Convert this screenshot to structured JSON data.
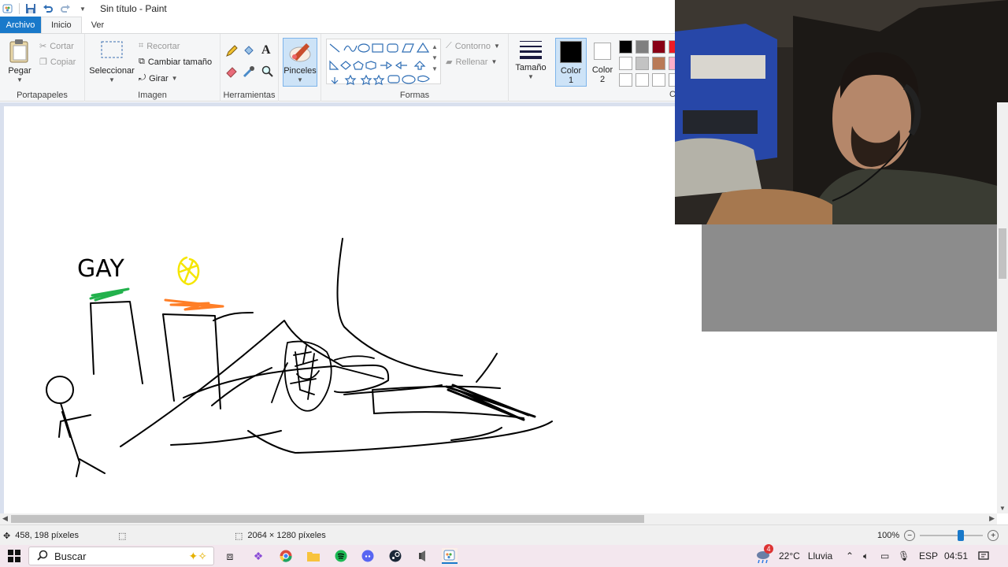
{
  "window": {
    "title": "Sin título - Paint"
  },
  "menu": {
    "file": "Archivo",
    "home": "Inicio",
    "view": "Ver"
  },
  "ribbon": {
    "clipboard": {
      "paste": "Pegar",
      "cut": "Cortar",
      "copy": "Copiar",
      "label": "Portapapeles"
    },
    "image": {
      "select": "Seleccionar",
      "crop": "Recortar",
      "resize": "Cambiar tamaño",
      "rotate": "Girar",
      "label": "Imagen"
    },
    "tools": {
      "label": "Herramientas"
    },
    "brushes": {
      "label": "Pinceles"
    },
    "shapes": {
      "outline": "Contorno",
      "fill": "Rellenar",
      "label": "Formas"
    },
    "size": {
      "label": "Tamaño"
    },
    "color1": {
      "label": "Color",
      "num": "1",
      "value": "#000000"
    },
    "color2": {
      "label": "Color",
      "num": "2",
      "value": "#ffffff"
    },
    "colors_group_partial": "C"
  },
  "palette": {
    "row1": [
      "#000000",
      "#7f7f7f",
      "#880015",
      "#ed1c24"
    ],
    "row2": [
      "#ffffff",
      "#c3c3c3",
      "#b97a57",
      "#ffaec9"
    ],
    "row3": [
      "#ffffff",
      "#ffffff",
      "#ffffff",
      "#ffffff"
    ]
  },
  "drawing": {
    "text": "GAY"
  },
  "status": {
    "cursor_pos": "458, 198 píxeles",
    "image_size": "2064 × 1280 píxeles",
    "zoom": "100%",
    "zoom_level": 0.66
  },
  "taskbar": {
    "search": "Buscar",
    "weather_temp": "22°C",
    "weather_text": "Lluvia",
    "weather_badge": "4",
    "lang": "ESP",
    "time": "04:51"
  }
}
